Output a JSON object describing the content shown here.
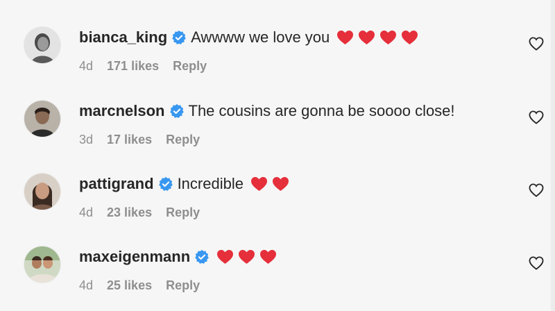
{
  "colors": {
    "heart_red": "#ed4956",
    "verified_blue": "#3897f0",
    "meta_gray": "#8e8e8e",
    "text_dark": "#262626",
    "background": "#f6f6f6"
  },
  "comments": [
    {
      "username": "bianca_king",
      "verified": true,
      "text": "Awwww we love you",
      "heart_emojis": 4,
      "time": "4d",
      "likes": "171 likes",
      "reply": "Reply",
      "avatar_icon": "avatar-bianca-king"
    },
    {
      "username": "marcnelson",
      "verified": true,
      "text": "The cousins are gonna be soooo close!",
      "heart_emojis": 0,
      "time": "3d",
      "likes": "17 likes",
      "reply": "Reply",
      "avatar_icon": "avatar-marcnelson"
    },
    {
      "username": "pattigrand",
      "verified": true,
      "text": "Incredible",
      "heart_emojis": 2,
      "time": "4d",
      "likes": "23 likes",
      "reply": "Reply",
      "avatar_icon": "avatar-pattigrand"
    },
    {
      "username": "maxeigenmann",
      "verified": true,
      "text": "",
      "heart_emojis": 3,
      "time": "4d",
      "likes": "25 likes",
      "reply": "Reply",
      "avatar_icon": "avatar-maxeigenmann"
    }
  ],
  "icons": {
    "verified": "verified-badge-icon",
    "heart_emoji": "red-heart-emoji-icon",
    "like": "heart-outline-icon"
  }
}
